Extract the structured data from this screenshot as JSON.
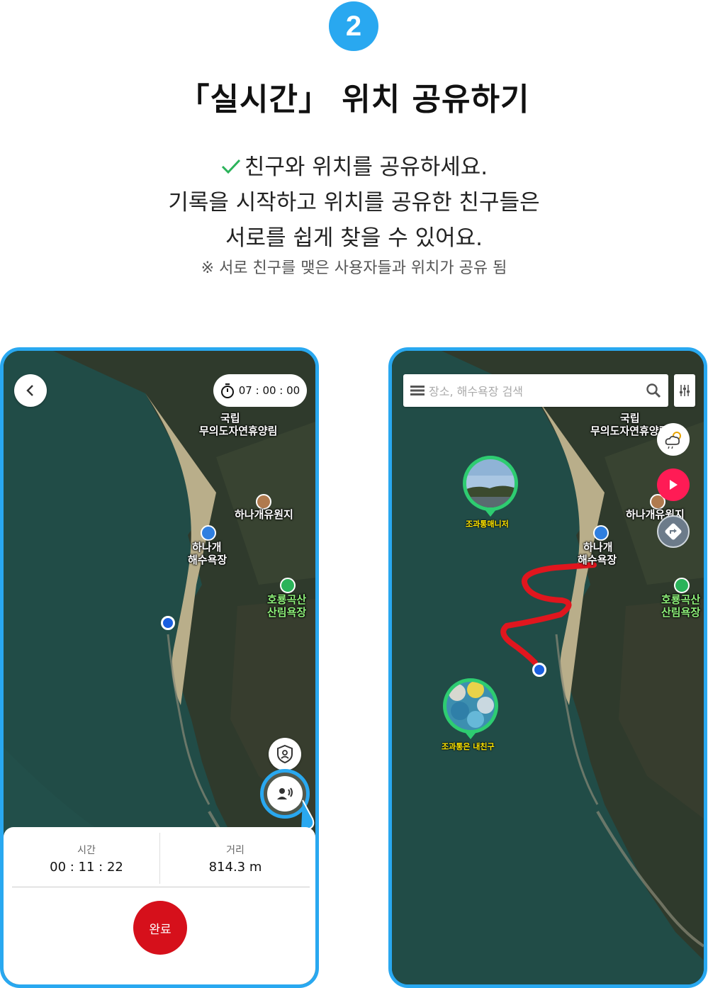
{
  "header": {
    "step_number": "2",
    "title": "「실시간」 위치 공유하기",
    "desc_line1": "친구와 위치를 공유하세요.",
    "desc_line2": "기록을 시작하고 위치를 공유한 친구들은",
    "desc_line3": "서로를 쉽게 찾을 수 있어요.",
    "note": "※ 서로 친구를 맺은 사용자들과 위치가 공유 됨"
  },
  "map_labels": {
    "park_line1": "국립",
    "park_line2": "무의도자연휴양림",
    "resort": "하나개유원지",
    "beach_line1": "하나개",
    "beach_line2": "해수욕장",
    "forest_line1": "호룡곡산",
    "forest_line2": "산림욕장"
  },
  "left_screen": {
    "timer": "07 : 00 : 00",
    "stat_time_label": "시간",
    "stat_time_value": "00 : 11 : 22",
    "stat_distance_label": "거리",
    "stat_distance_value": "814.3 m",
    "done_label": "완료"
  },
  "right_screen": {
    "search_placeholder": "장소, 해수욕장 검색",
    "friend1_name": "조과통매니저",
    "friend2_name": "조과통은 내친구"
  },
  "colors": {
    "accent_blue": "#29a8f0",
    "done_red": "#d6101b",
    "play_pink": "#ff1b55",
    "track_red": "#e0161e",
    "friend_ring": "#2ecc71"
  }
}
